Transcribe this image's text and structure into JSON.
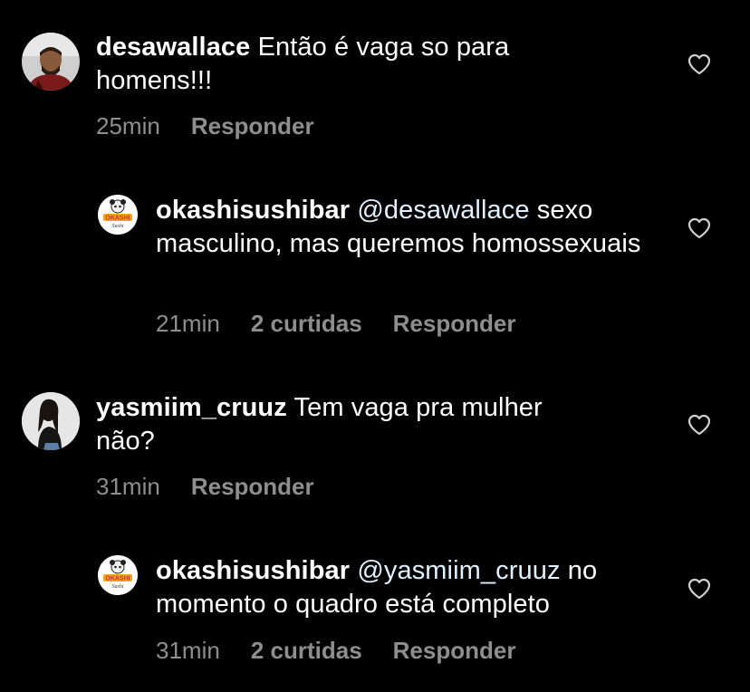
{
  "comments": [
    {
      "username": "desawallace",
      "mention": "",
      "text": "Então é vaga so para homens!!!",
      "time": "25min",
      "likes": "",
      "reply_label": "Responder",
      "avatar_icon": "user-photo-man"
    },
    {
      "username": "okashisushibar",
      "mention": "@desawallace",
      "text": "sexo masculino, mas queremos homossexuais",
      "time": "21min",
      "likes": "2 curtidas",
      "reply_label": "Responder",
      "avatar_icon": "okashi-sushi-logo"
    },
    {
      "username": "yasmiim_cruuz",
      "mention": "",
      "text": "Tem vaga pra mulher não?",
      "time": "31min",
      "likes": "",
      "reply_label": "Responder",
      "avatar_icon": "user-photo-woman"
    },
    {
      "username": "okashisushibar",
      "mention": "@yasmiim_cruuz",
      "text": "no momento o quadro está completo",
      "time": "31min",
      "likes": "2 curtidas",
      "reply_label": "Responder",
      "avatar_icon": "okashi-sushi-logo"
    }
  ],
  "logo_text": "OKASHI",
  "colors": {
    "background": "#000000",
    "text": "#ffffff",
    "meta": "#8e8e8e",
    "mention": "#e0f1ff"
  }
}
